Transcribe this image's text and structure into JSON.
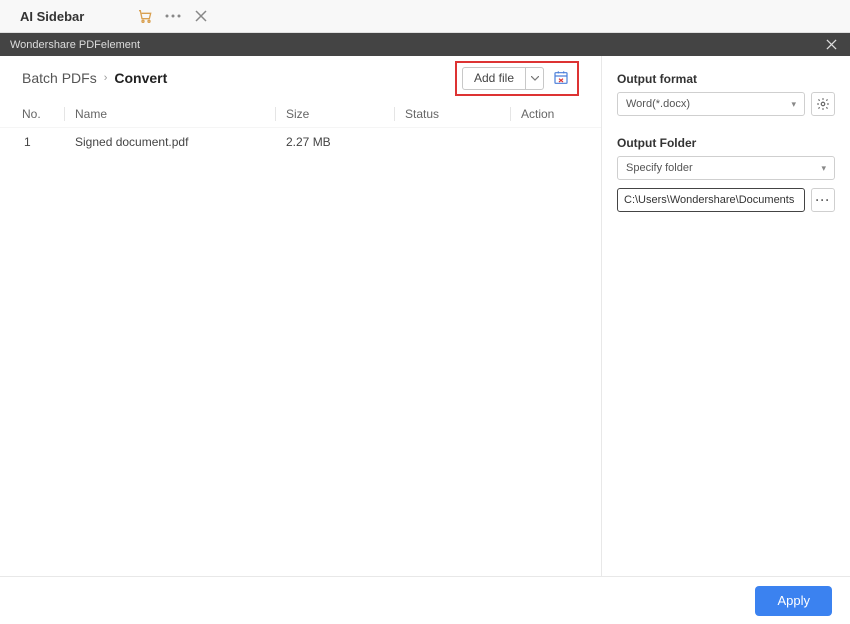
{
  "topbar": {
    "title": "AI Sidebar"
  },
  "app": {
    "title": "Wondershare PDFelement"
  },
  "breadcrumb": {
    "root": "Batch PDFs",
    "current": "Convert"
  },
  "toolbar": {
    "add_file_label": "Add file"
  },
  "table": {
    "headers": {
      "no": "No.",
      "name": "Name",
      "size": "Size",
      "status": "Status",
      "action": "Action"
    },
    "rows": [
      {
        "no": "1",
        "name": "Signed document.pdf",
        "size": "2.27 MB",
        "status": "",
        "action": ""
      }
    ]
  },
  "output": {
    "format_label": "Output format",
    "format_value": "Word(*.docx)",
    "folder_label": "Output Folder",
    "folder_mode": "Specify folder",
    "folder_path": "C:\\Users\\Wondershare\\Documents"
  },
  "footer": {
    "apply_label": "Apply"
  }
}
